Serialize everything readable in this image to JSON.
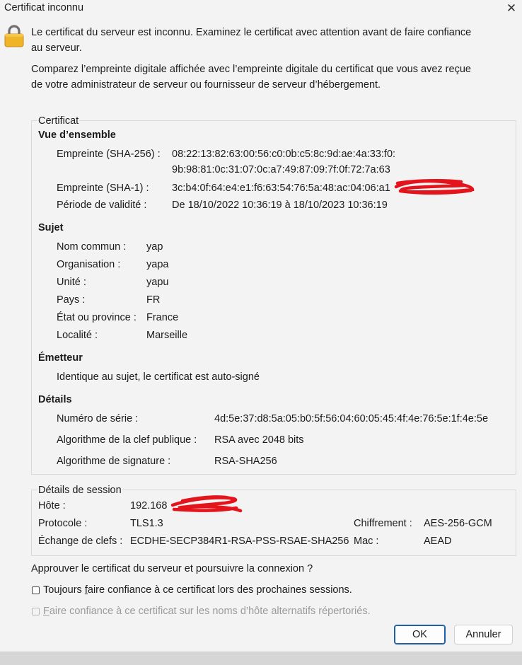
{
  "window": {
    "title": "Certificat inconnu"
  },
  "intro": {
    "warning": "Le certificat du serveur est inconnu. Examinez le certificat avec attention avant de faire confiance au serveur.",
    "compare": "Comparez l’empreinte digitale affichée avec l’empreinte digitale du certificat que vous avez reçue de votre administrateur de serveur ou fournisseur de serveur d’hébergement."
  },
  "certificate": {
    "legend": "Certificat",
    "overview": {
      "heading": "Vue d’ensemble",
      "sha256_label": "Empreinte (SHA-256) :",
      "sha256_line1": "08:22:13:82:63:00:56:c0:0b:c5:8c:9d:ae:4a:33:f0:",
      "sha256_line2": "9b:98:81:0c:31:07:0c:a7:49:87:09:7f:0f:72:7a:63",
      "sha1_label": "Empreinte (SHA-1) :",
      "sha1_value": "3c:b4:0f:64:e4:e1:f6:63:54:76:5a:48:ac:04:06:a1",
      "validity_label": "Période de validité :",
      "validity_value": "De 18/10/2022 10:36:19 à 18/10/2023 10:36:19"
    },
    "subject": {
      "heading": "Sujet",
      "rows": [
        {
          "label": "Nom commun :",
          "value": "yap"
        },
        {
          "label": "Organisation :",
          "value": "yapa"
        },
        {
          "label": "Unité :",
          "value": "yapu"
        },
        {
          "label": "Pays :",
          "value": "FR"
        },
        {
          "label": "État ou province :",
          "value": "France"
        },
        {
          "label": "Localité :",
          "value": "Marseille"
        }
      ]
    },
    "issuer": {
      "heading": "Émetteur",
      "text": "Identique au sujet, le certificat est auto-signé"
    },
    "details": {
      "heading": "Détails",
      "serial_label": "Numéro de série :",
      "serial_value": "4d:5e:37:d8:5a:05:b0:5f:56:04:60:05:45:4f:4e:76:5e:1f:4e:5e",
      "pubkey_label": "Algorithme de la clef publique :",
      "pubkey_value": "RSA avec 2048 bits",
      "sig_label": "Algorithme de signature :",
      "sig_value": "RSA-SHA256"
    }
  },
  "session": {
    "legend": "Détails de session",
    "host_label": "Hôte :",
    "host_value": "192.168",
    "protocol_label": "Protocole :",
    "protocol_value": "TLS1.3",
    "cipher_label": "Chiffrement :",
    "cipher_value": "AES-256-GCM",
    "kex_label": "Échange de clefs :",
    "kex_value": "ECDHE-SECP384R1-RSA-PSS-RSAE-SHA256",
    "mac_label": "Mac :",
    "mac_value": "AEAD"
  },
  "approve_question": "Approuver le certificat du serveur et poursuivre la connexion ?",
  "checkboxes": {
    "always_pre": "Toujours ",
    "always_acc": "f",
    "always_post": "aire confiance à ce certificat lors des prochaines sessions.",
    "alt_acc": "F",
    "alt_post": "aire confiance à ce certificat sur les noms d’hôte alternatifs répertoriés.",
    "always_checked": false,
    "alt_checked": false,
    "alt_enabled": false
  },
  "buttons": {
    "ok": "OK",
    "cancel": "Annuler"
  },
  "colors": {
    "accent": "#1f5fa8",
    "redaction": "#e3141b",
    "lock_body": "#f0b429"
  }
}
